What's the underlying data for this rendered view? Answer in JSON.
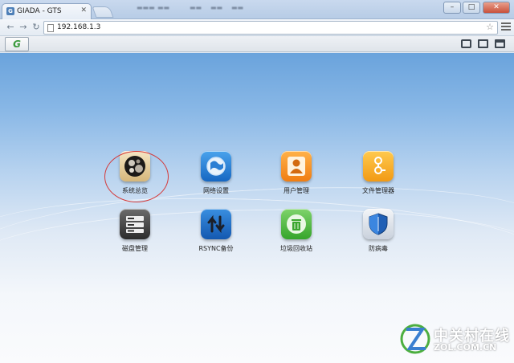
{
  "browser": {
    "tab_title": "GIADA - GTS",
    "tab_favicon_letter": "G",
    "url": "192.168.1.3",
    "window_controls": {
      "minimize": "–",
      "maximize": "□",
      "close": "✕"
    }
  },
  "app_toolbar": {
    "logo_text": "G",
    "icons": [
      "chat-icon",
      "monitor-icon",
      "calendar-icon"
    ]
  },
  "apps": [
    {
      "label": "系统总览",
      "icon": "system-overview-icon"
    },
    {
      "label": "网络设置",
      "icon": "network-settings-icon"
    },
    {
      "label": "用户管理",
      "icon": "user-management-icon"
    },
    {
      "label": "文件管理器",
      "icon": "file-manager-icon"
    },
    {
      "label": "磁盘管理",
      "icon": "disk-management-icon"
    },
    {
      "label": "RSYNC备份",
      "icon": "rsync-backup-icon"
    },
    {
      "label": "垃圾回收站",
      "icon": "recycle-bin-icon"
    },
    {
      "label": "防病毒",
      "icon": "antivirus-icon"
    }
  ],
  "watermark": {
    "brand": "中关村在线",
    "url": "ZOL.COM.CN"
  },
  "colors": {
    "highlight_ring": "#d43a3a",
    "desktop_top": "#6aa3dc",
    "logo_green": "#3a9a3c"
  }
}
